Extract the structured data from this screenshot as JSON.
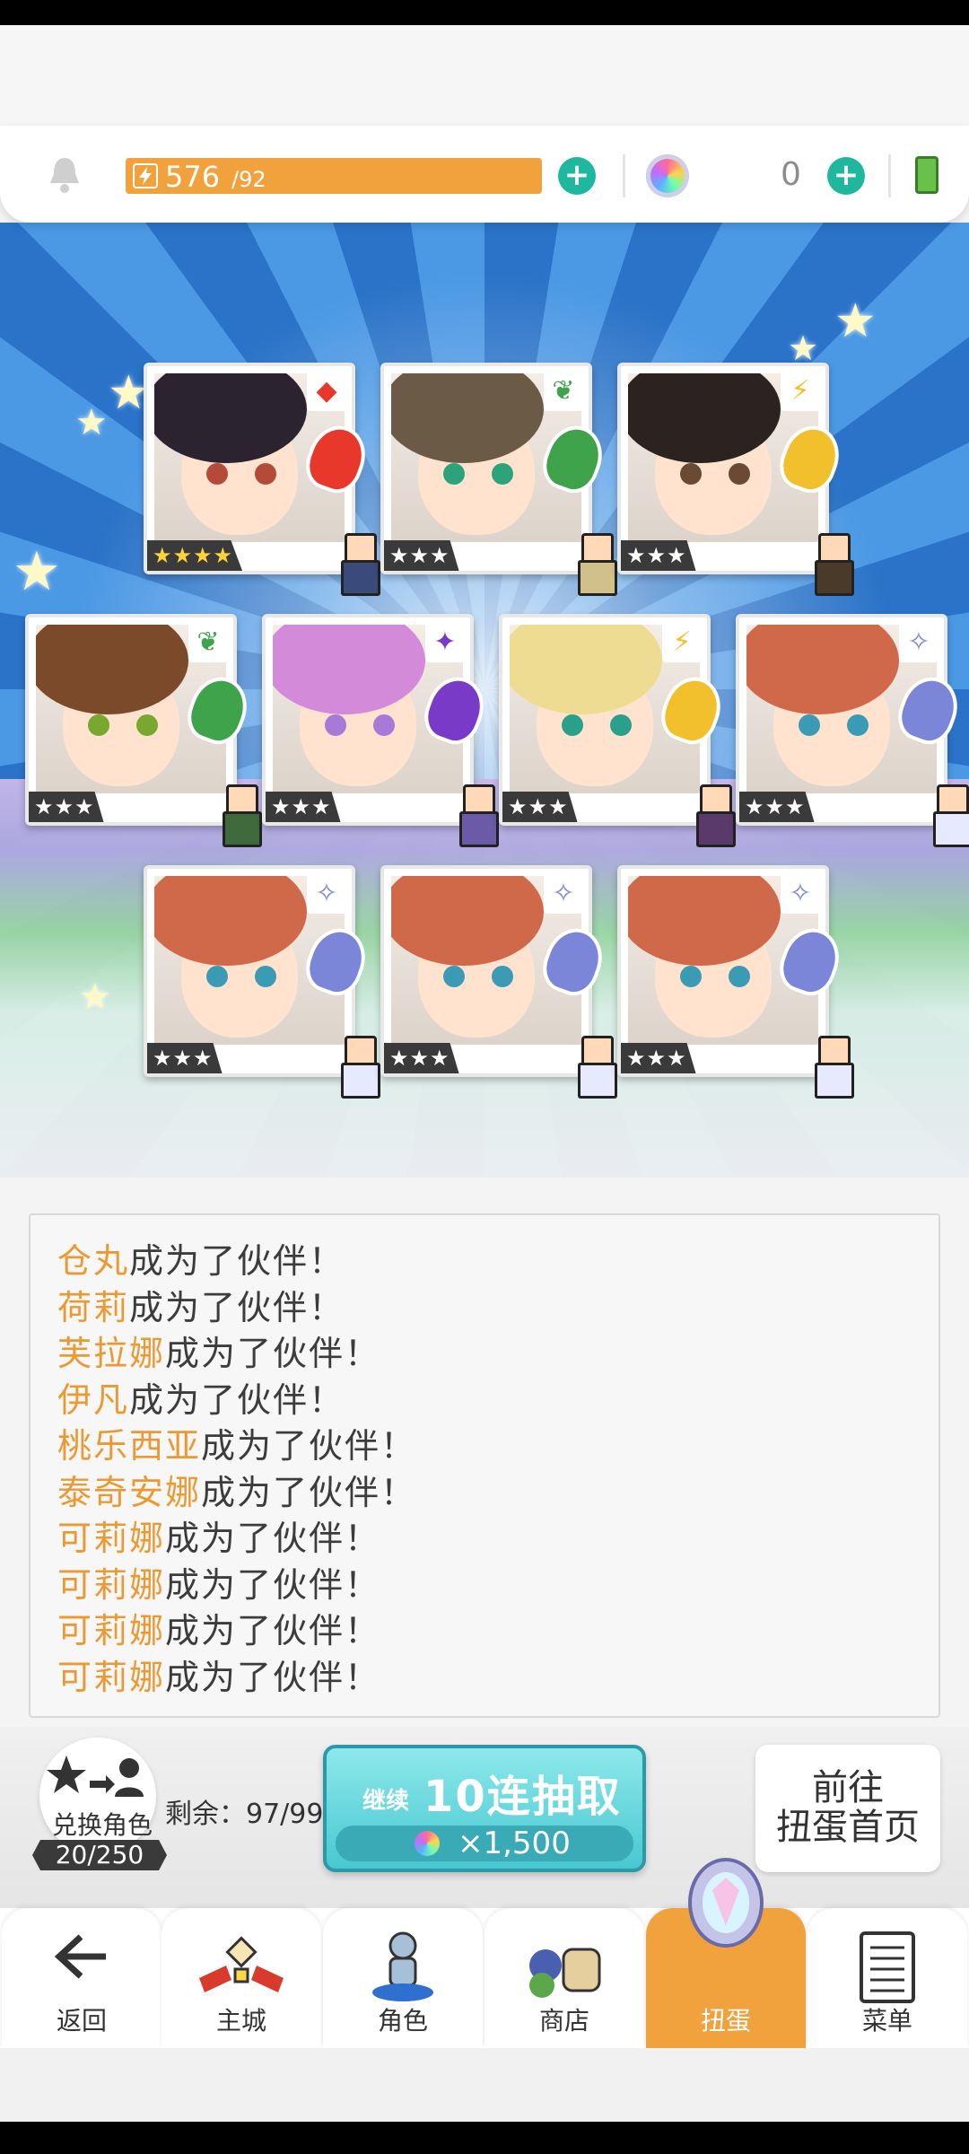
{
  "header": {
    "stamina_current": "576",
    "stamina_max": "/92",
    "gem_count": "0",
    "icons": [
      "bell-icon",
      "lightning-icon",
      "plus-icon",
      "rainbow-gem-icon",
      "battery-icon"
    ]
  },
  "cards": [
    {
      "element": "fire",
      "element_glyph": "◆",
      "rarity": "★★★★",
      "hair": "#2b2430",
      "eye": "#b44a3a",
      "crest": "#e8382b",
      "sprite_body": "#3a4a7a"
    },
    {
      "element": "wind",
      "element_glyph": "❦",
      "rarity": "★★★",
      "hair": "#6b5a46",
      "eye": "#2ea37b",
      "crest": "#3ea34a",
      "sprite_body": "#d0c08a"
    },
    {
      "element": "thunder",
      "element_glyph": "⚡",
      "rarity": "★★★",
      "hair": "#2a2320",
      "eye": "#6b4a34",
      "crest": "#f1c02c",
      "sprite_body": "#4a3a2a"
    },
    {
      "element": "wind",
      "element_glyph": "❦",
      "rarity": "★★★",
      "hair": "#7a4a2a",
      "eye": "#79a830",
      "crest": "#3ea34a",
      "sprite_body": "#3f6a3b"
    },
    {
      "element": "dark",
      "element_glyph": "✦",
      "rarity": "★★★",
      "hair": "#d38ad8",
      "eye": "#a67ad6",
      "crest": "#7a3ac8",
      "sprite_body": "#6a5aa8"
    },
    {
      "element": "thunder",
      "element_glyph": "⚡",
      "rarity": "★★★",
      "hair": "#efdc93",
      "eye": "#2aa08a",
      "crest": "#f1c02c",
      "sprite_body": "#5a3a6a"
    },
    {
      "element": "light",
      "element_glyph": "✧",
      "rarity": "★★★",
      "hair": "#d0684a",
      "eye": "#3b9bb5",
      "crest": "#7c86d8",
      "sprite_body": "#e7e9ff"
    },
    {
      "element": "light",
      "element_glyph": "✧",
      "rarity": "★★★",
      "hair": "#d0684a",
      "eye": "#3b9bb5",
      "crest": "#7c86d8",
      "sprite_body": "#e7e9ff"
    },
    {
      "element": "light",
      "element_glyph": "✧",
      "rarity": "★★★",
      "hair": "#d0684a",
      "eye": "#3b9bb5",
      "crest": "#7c86d8",
      "sprite_body": "#e7e9ff"
    },
    {
      "element": "light",
      "element_glyph": "✧",
      "rarity": "★★★",
      "hair": "#d0684a",
      "eye": "#3b9bb5",
      "crest": "#7c86d8",
      "sprite_body": "#e7e9ff"
    }
  ],
  "log": [
    {
      "name": "仓丸",
      "text": "成为了伙伴！"
    },
    {
      "name": "荷莉",
      "text": "成为了伙伴！"
    },
    {
      "name": "芙拉娜",
      "text": "成为了伙伴！"
    },
    {
      "name": "伊凡",
      "text": "成为了伙伴！"
    },
    {
      "name": "桃乐西亚",
      "text": "成为了伙伴！"
    },
    {
      "name": "泰奇安娜",
      "text": "成为了伙伴！"
    },
    {
      "name": "可莉娜",
      "text": "成为了伙伴！"
    },
    {
      "name": "可莉娜",
      "text": "成为了伙伴！"
    },
    {
      "name": "可莉娜",
      "text": "成为了伙伴！"
    },
    {
      "name": "可莉娜",
      "text": "成为了伙伴！"
    }
  ],
  "actions": {
    "exchange_label": "兑换角色",
    "exchange_count": "20/250",
    "remaining": "剩余：97/99",
    "pull_sub": "继续",
    "pull_main": "10连抽取",
    "pull_cost": "×1,500",
    "home_line1": "前往",
    "home_line2": "扭蛋首页"
  },
  "nav": {
    "tabs": [
      {
        "label": "返回",
        "icon": "back-arrow-icon"
      },
      {
        "label": "主城",
        "icon": "castle-icon"
      },
      {
        "label": "角色",
        "icon": "character-icon"
      },
      {
        "label": "商店",
        "icon": "shop-icon"
      },
      {
        "label": "扭蛋",
        "icon": "gacha-icon",
        "active": true
      },
      {
        "label": "菜单",
        "icon": "menu-icon"
      }
    ]
  },
  "colors": {
    "accent": "#f2a23d",
    "teal": "#1fb79e",
    "name_highlight": "#eb9a33"
  }
}
